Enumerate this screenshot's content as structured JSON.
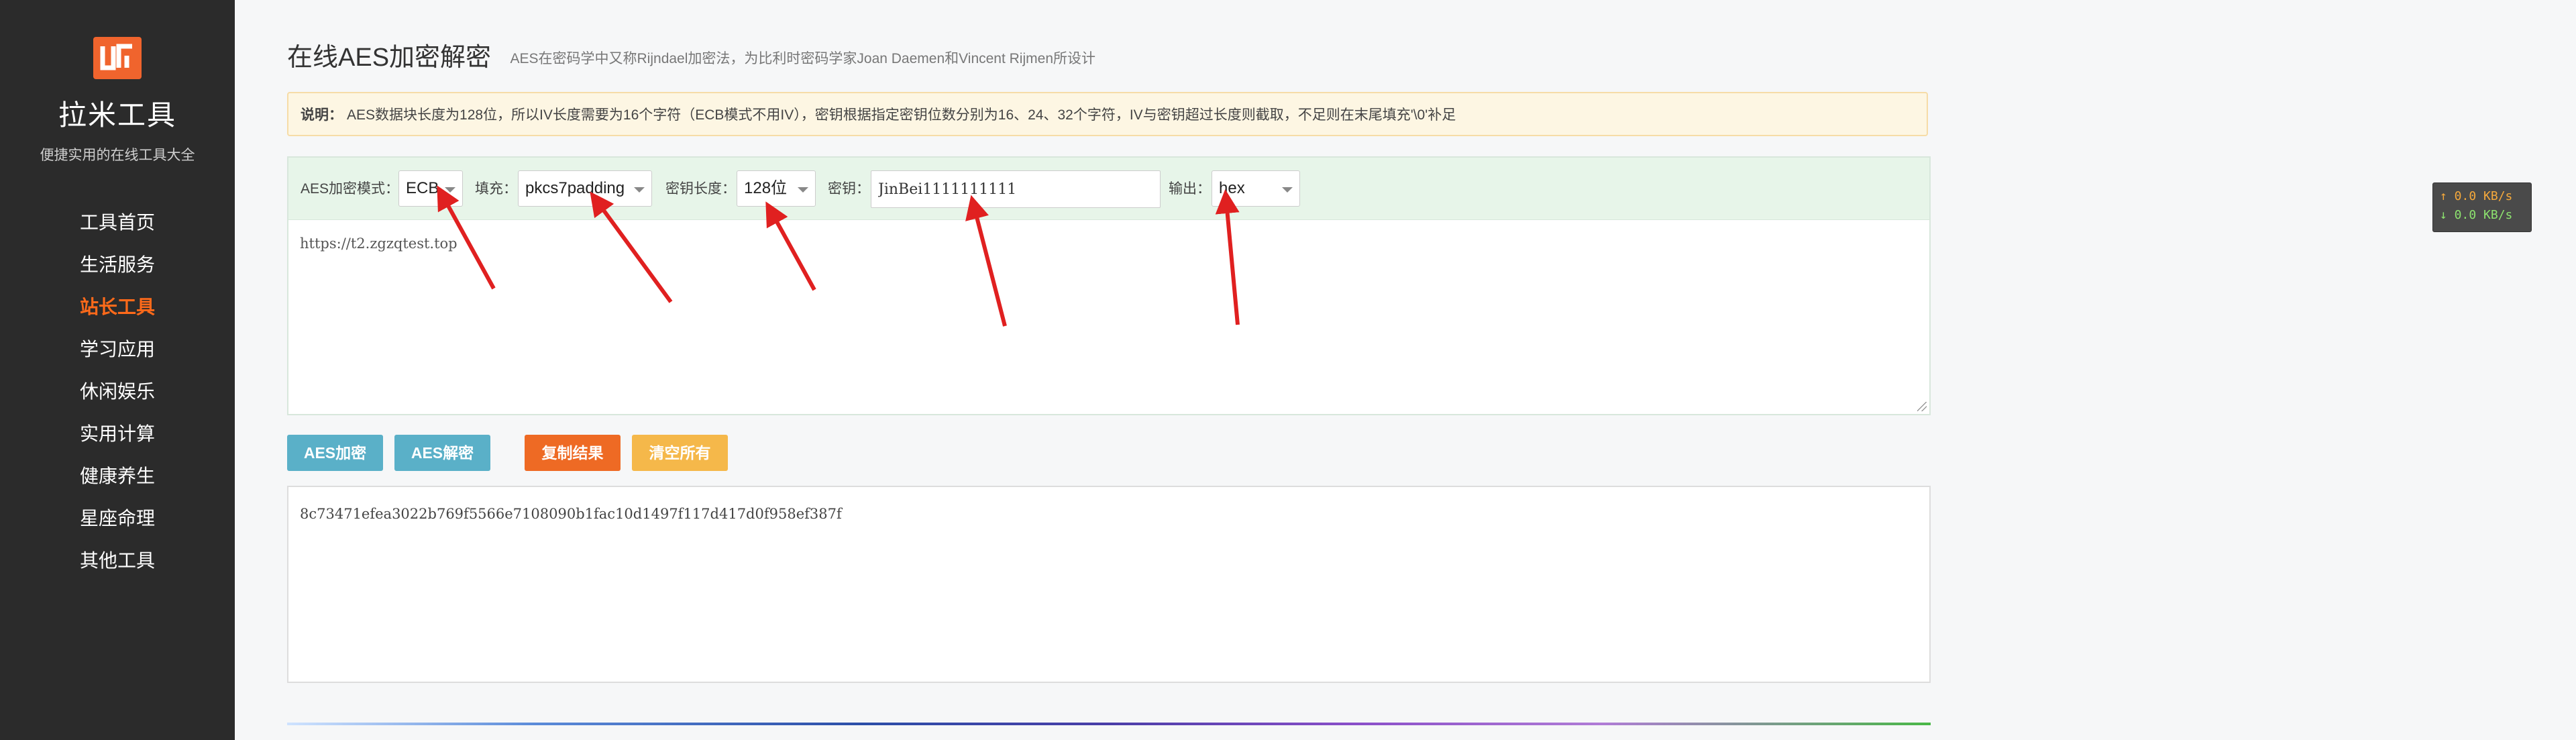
{
  "sidebar": {
    "brand": "拉米工具",
    "slogan": "便捷实用的在线工具大全",
    "nav": [
      {
        "label": "工具首页"
      },
      {
        "label": "生活服务"
      },
      {
        "label": "站长工具",
        "active": true
      },
      {
        "label": "学习应用"
      },
      {
        "label": "休闲娱乐"
      },
      {
        "label": "实用计算"
      },
      {
        "label": "健康养生"
      },
      {
        "label": "星座命理"
      },
      {
        "label": "其他工具"
      }
    ]
  },
  "main": {
    "title": "在线AES加密解密",
    "subtitle": "AES在密码学中又称Rijndael加密法，为比利时密码学家Joan Daemen和Vincent Rijmen所设计",
    "notice_label": "说明：",
    "notice_text": "AES数据块长度为128位，所以IV长度需要为16个字符（ECB模式不用IV），密钥根据指定密钥位数分别为16、24、32个字符，IV与密钥超过长度则截取，不足则在末尾填充'\\0'补足"
  },
  "options": {
    "mode_label": "AES加密模式：",
    "mode_value": "ECB",
    "padding_label": "填充：",
    "padding_value": "pkcs7padding",
    "keylen_label": "密钥长度：",
    "keylen_value": "128位",
    "key_label": "密钥：",
    "key_value": "JinBei1111111111",
    "output_label": "输出：",
    "output_value": "hex"
  },
  "input_text": "https://t2.zgzqtest.top",
  "buttons": {
    "encrypt": "AES加密",
    "decrypt": "AES解密",
    "copy": "复制结果",
    "clear": "清空所有"
  },
  "output_text": "8c73471efea3022b769f5566e7108090b1fac10d1497f117d417d0f958ef387f",
  "speed": {
    "up": "↑ 0.0 KB/s",
    "down": "↓ 0.0 KB/s"
  },
  "colors": {
    "accent": "#ee6a24",
    "sidebar_bg": "#2b2b2b",
    "button_blue": "#5ab0c8",
    "button_yellow": "#f5b84a",
    "annotation_arrow": "#e02020"
  }
}
